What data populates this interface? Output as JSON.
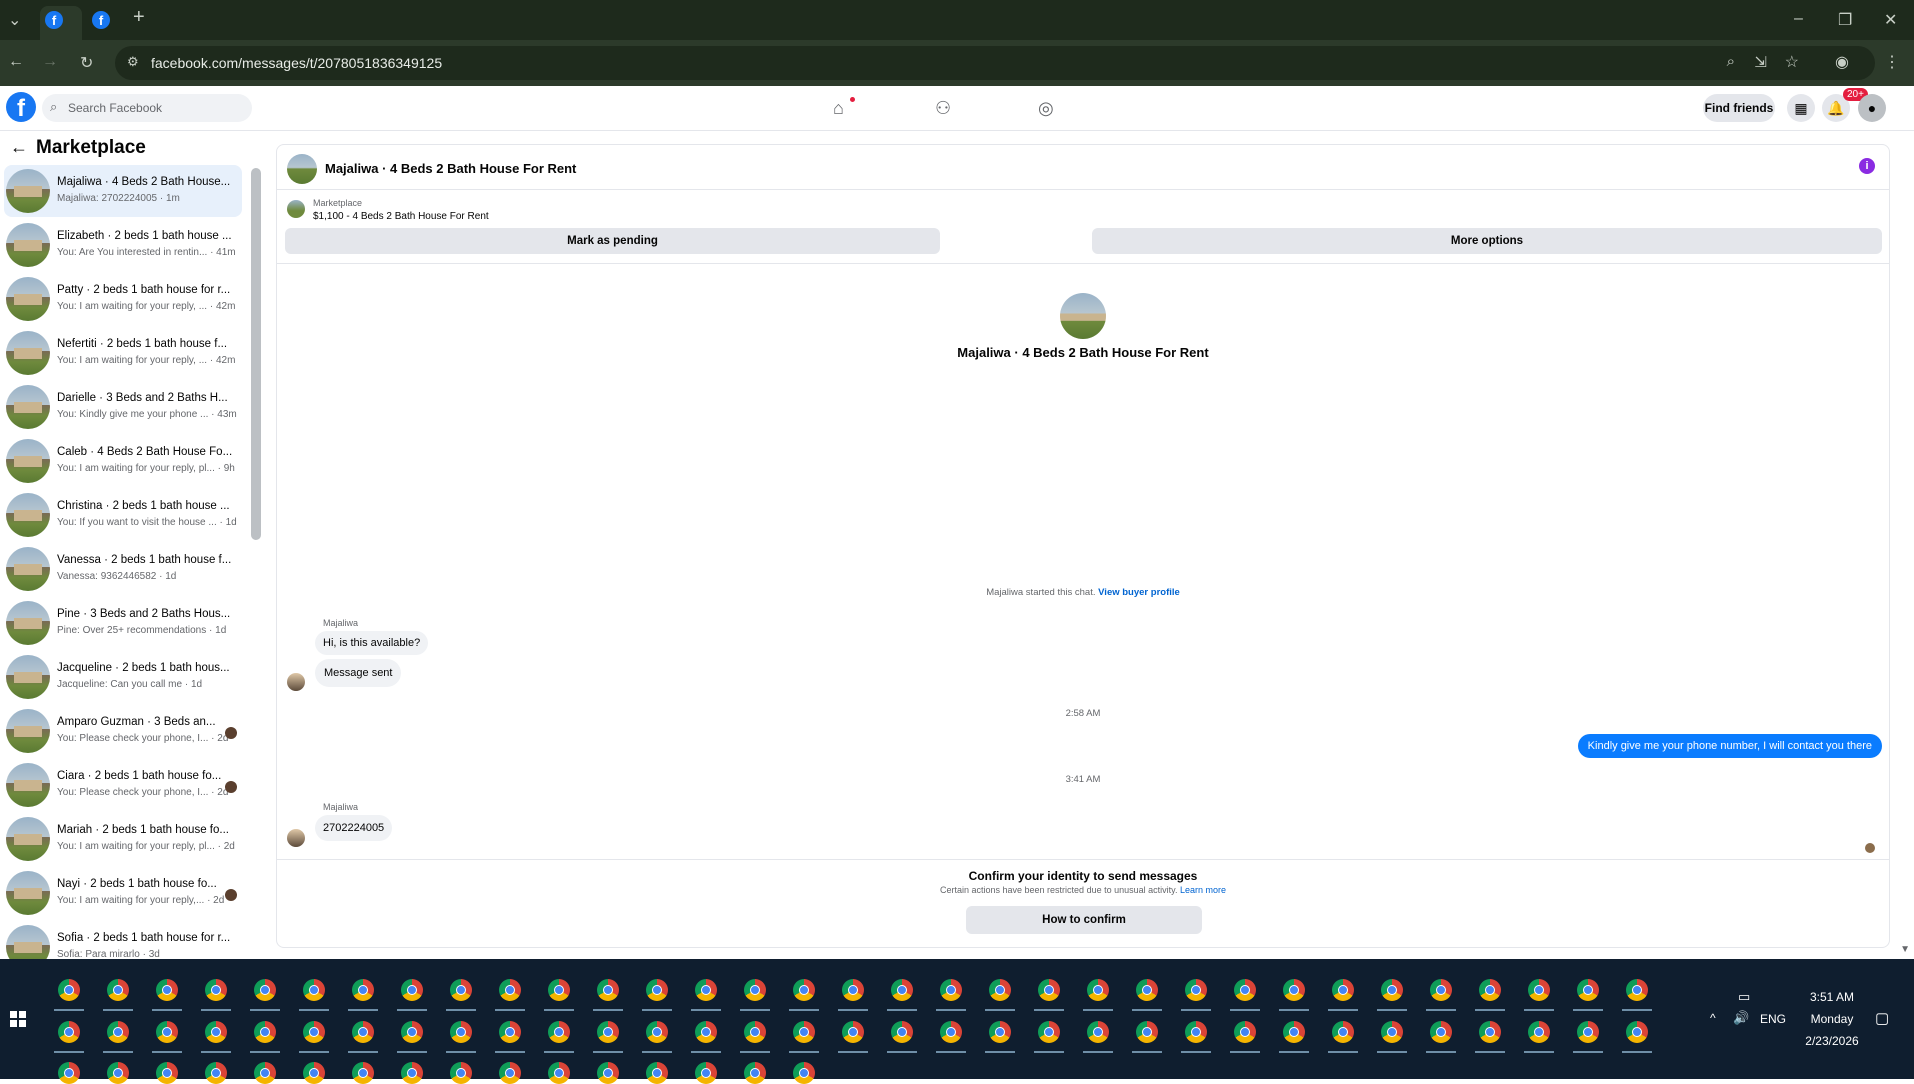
{
  "browser": {
    "url": "facebook.com/messages/t/2078051836349125",
    "new_tab": "+"
  },
  "fb": {
    "search_placeholder": "Search Facebook",
    "find_friends": "Find friends",
    "notif_badge": "20+"
  },
  "sidebar": {
    "title": "Marketplace",
    "items": [
      {
        "name": "Majaliwa · 4 Beds 2 Bath House...",
        "sub": "Majaliwa: 2702224005 · 1m",
        "active": true
      },
      {
        "name": "Elizabeth · 2 beds 1 bath house ...",
        "sub": "You: Are You interested in rentin... · 41m"
      },
      {
        "name": "Patty · 2 beds 1 bath house for r...",
        "sub": "You: I am waiting for your reply, ... · 42m"
      },
      {
        "name": "Nefertiti · 2 beds 1 bath house f...",
        "sub": "You: I am waiting for your reply, ... · 42m"
      },
      {
        "name": "Darielle · 3 Beds and 2 Baths H...",
        "sub": "You: Kindly give me your phone ... · 43m"
      },
      {
        "name": "Caleb · 4 Beds 2 Bath House Fo...",
        "sub": "You: I am waiting for your reply, pl... · 9h"
      },
      {
        "name": "Christina · 2 beds 1 bath house ...",
        "sub": "You: If you want to visit the house ... · 1d"
      },
      {
        "name": "Vanessa · 2 beds 1 bath house f...",
        "sub": "Vanessa: 9362446582 · 1d"
      },
      {
        "name": "Pine · 3 Beds and 2 Baths Hous...",
        "sub": "Pine: Over 25+ recommendations · 1d"
      },
      {
        "name": "Jacqueline · 2 beds 1 bath hous...",
        "sub": "Jacqueline: Can you call me · 1d"
      },
      {
        "name": "Amparo Guzman · 3 Beds an...",
        "sub": "You: Please check your phone, I... · 2d"
      },
      {
        "name": "Ciara · 2 beds 1 bath house fo...",
        "sub": "You: Please check your phone, I... · 2d"
      },
      {
        "name": "Mariah · 2 beds 1 bath house fo...",
        "sub": "You: I am waiting for your reply, pl... · 2d"
      },
      {
        "name": "Nayi · 2 beds 1 bath house fo...",
        "sub": "You: I am waiting for your reply,... · 2d"
      },
      {
        "name": "Sofia · 2 beds 1 bath house for r...",
        "sub": "Sofia: Para mirarlo · 3d"
      }
    ]
  },
  "chat": {
    "header_title": "Majaliwa · 4 Beds 2 Bath House For Rent",
    "marketplace_label": "Marketplace",
    "listing_line": "$1,100 - 4 Beds 2 Bath House For Rent",
    "mark_pending": "Mark as pending",
    "more_options": "More options",
    "profile_title": "Majaliwa · 4 Beds 2 Bath House For Rent",
    "started_text": "Majaliwa started this chat.",
    "view_buyer": "View buyer profile",
    "sender1": "Majaliwa",
    "msg1": "Hi, is this available?",
    "msg2": "Message sent",
    "time1": "2:58 AM",
    "msg_out": "Kindly give me your phone number, I will contact you there",
    "time2": "3:41 AM",
    "sender2": "Majaliwa",
    "msg3": "2702224005",
    "confirm_title": "Confirm your identity to send messages",
    "confirm_sub": "Certain actions have been restricted due to unusual activity.",
    "learn_more": "Learn more",
    "confirm_btn": "How to confirm"
  },
  "taskbar": {
    "time": "3:51 AM",
    "day": "Monday",
    "date": "2/23/2026",
    "lang": "ENG"
  }
}
